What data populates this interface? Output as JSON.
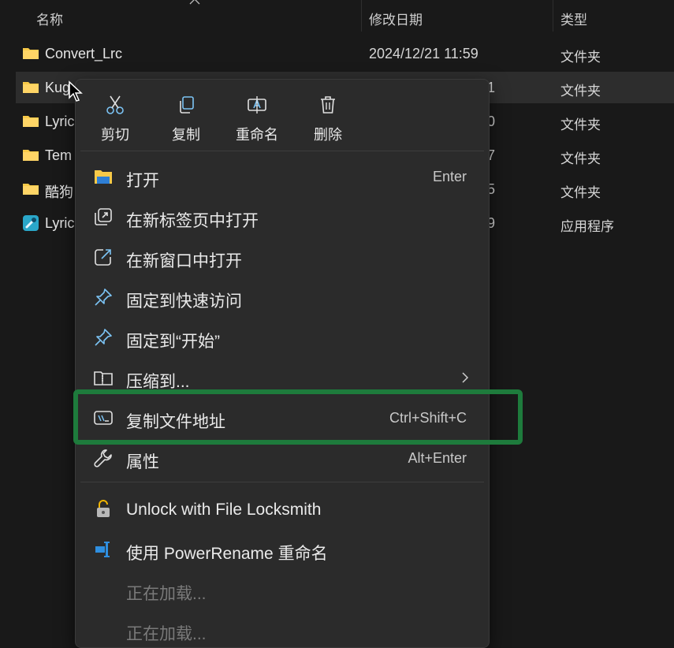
{
  "header": {
    "name_label": "名称",
    "date_label": "修改日期",
    "type_label": "类型"
  },
  "files": [
    {
      "name": "Convert_Lrc",
      "date": "2024/12/21 11:59",
      "type": "文件夹",
      "icon": "folder-icon",
      "selected": false
    },
    {
      "name": "Kug",
      "date": "1",
      "type": "文件夹",
      "icon": "folder-icon",
      "selected": true
    },
    {
      "name": "Lyric",
      "date": "0",
      "type": "文件夹",
      "icon": "folder-icon",
      "selected": false
    },
    {
      "name": "Tem",
      "date": "7",
      "type": "文件夹",
      "icon": "folder-icon",
      "selected": false
    },
    {
      "name": "酷狗",
      "date": "5",
      "type": "文件夹",
      "icon": "folder-icon",
      "selected": false
    },
    {
      "name": "Lyric",
      "date": "9",
      "type": "应用程序",
      "icon": "app-icon",
      "selected": false
    }
  ],
  "context_menu": {
    "quick_actions": [
      {
        "label": "剪切",
        "icon": "cut-icon"
      },
      {
        "label": "复制",
        "icon": "copy-icon"
      },
      {
        "label": "重命名",
        "icon": "rename-icon"
      },
      {
        "label": "删除",
        "icon": "delete-icon"
      }
    ],
    "items": [
      {
        "label": "打开",
        "shortcut": "Enter",
        "icon": "open-folder-icon"
      },
      {
        "label": "在新标签页中打开",
        "shortcut": "",
        "icon": "new-tab-icon"
      },
      {
        "label": "在新窗口中打开",
        "shortcut": "",
        "icon": "new-window-icon"
      },
      {
        "label": "固定到快速访问",
        "shortcut": "",
        "icon": "pin-icon"
      },
      {
        "label": "固定到“开始”",
        "shortcut": "",
        "icon": "pin-icon"
      },
      {
        "label": "压缩到...",
        "shortcut": "",
        "icon": "zip-folder-icon",
        "submenu": true
      },
      {
        "label": "复制文件地址",
        "shortcut": "Ctrl+Shift+C",
        "icon": "copy-path-icon",
        "highlighted": true
      },
      {
        "label": "属性",
        "shortcut": "Alt+Enter",
        "icon": "wrench-icon"
      }
    ],
    "extension_items": [
      {
        "label": "Unlock with File Locksmith",
        "icon": "lock-icon"
      },
      {
        "label": "使用 PowerRename 重命名",
        "icon": "powerrename-icon"
      },
      {
        "label": "正在加载...",
        "disabled": true
      },
      {
        "label": "正在加载...",
        "disabled": true
      }
    ]
  },
  "colors": {
    "background": "#191919",
    "menu_background": "#2b2b2b",
    "folder": "#f7c948",
    "accent_icon": "#60b6f0",
    "highlight_border": "#1e7b3c"
  }
}
